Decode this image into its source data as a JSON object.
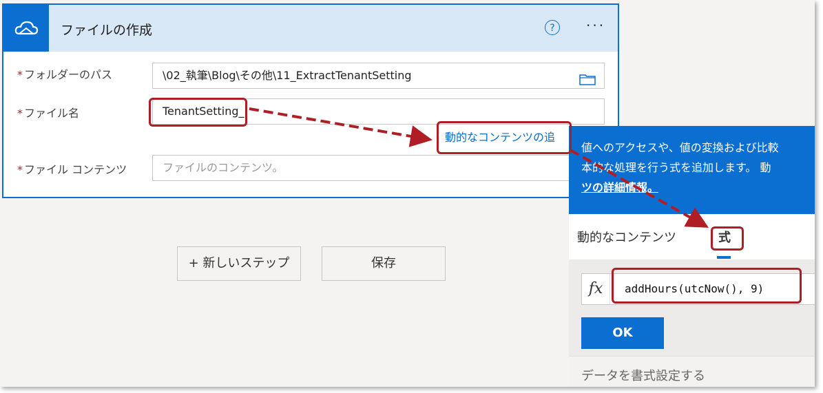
{
  "card": {
    "title": "ファイルの作成",
    "help_label": "?",
    "more_label": "···"
  },
  "fields": {
    "folder_label": "フォルダーのパス",
    "folder_value": "\\02_執筆\\Blog\\その他\\11_ExtractTenantSetting",
    "filename_label": "ファイル名",
    "filename_value": "TenantSetting_",
    "content_label": "ファイル コンテンツ",
    "content_placeholder": "ファイルのコンテンツ。",
    "required_mark": "*"
  },
  "buttons": {
    "new_step": "+ 新しいステップ",
    "save": "保存"
  },
  "dynamic_link": "動的なコンテンツの追",
  "panel": {
    "description_line1": "値へのアクセスや、値の変換および比較",
    "description_line2": "本的な処理を行う式を追加します。 動",
    "more_link": "ツの詳細情報。",
    "tab_dynamic": "動的なコンテンツ",
    "tab_expression": "式",
    "fx_label": "fx",
    "expression": "addHours(utcNow(), 9)",
    "ok_label": "OK",
    "format_label": "データを書式設定する"
  },
  "colors": {
    "accent": "#0b6fd2",
    "highlight": "#b01e25"
  }
}
